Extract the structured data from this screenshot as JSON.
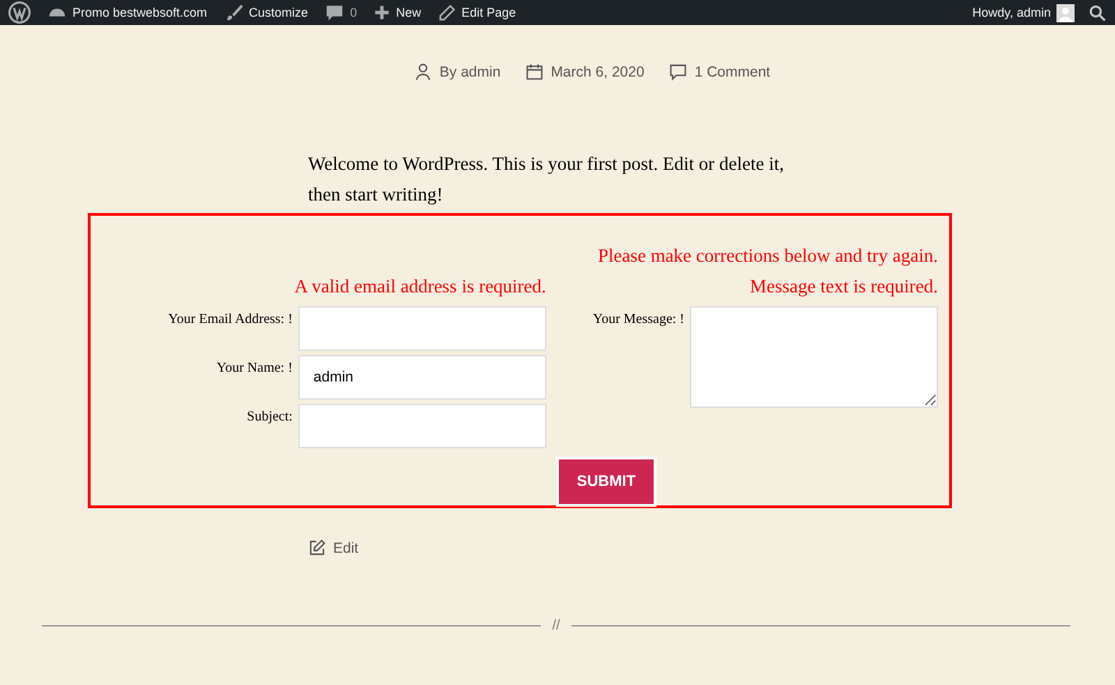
{
  "admin_bar": {
    "site": "Promo bestwebsoft.com",
    "customize": "Customize",
    "comments": "0",
    "new": "New",
    "edit": "Edit Page",
    "greeting": "Howdy, admin"
  },
  "post_meta": {
    "author": "By admin",
    "date": "March 6, 2020",
    "comments": "1 Comment"
  },
  "content": "Welcome to WordPress. This is your first post. Edit or delete it, then start writing!",
  "form": {
    "error": "Please make corrections below and try again.",
    "left": {
      "error": "A valid email address is required.",
      "fields": [
        {
          "label": "Your Email Address: !"
        },
        {
          "label": "Your Name: !",
          "value": "admin"
        },
        {
          "label": "Subject:"
        }
      ]
    },
    "right": {
      "error": "Message text is required.",
      "label": "Your Message: !"
    },
    "submit": "SUBMIT"
  },
  "edit_link": "Edit",
  "separator": "//"
}
